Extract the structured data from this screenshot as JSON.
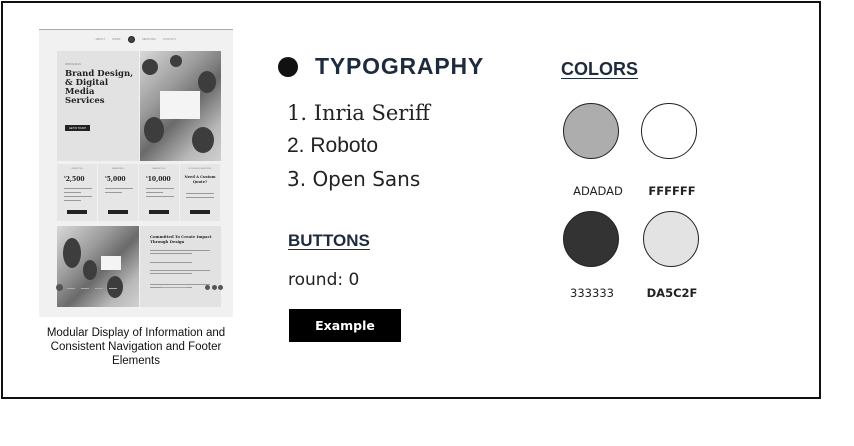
{
  "mockup": {
    "nav": [
      "ABOUT",
      "WORK",
      "SERVICES",
      "CONTACT"
    ],
    "hero_kicker": "WEB DESIGN",
    "hero_title": "Brand Design, & Digital Media Services",
    "hero_button": "GET IN TOUCH",
    "pricing": [
      {
        "kicker": "WEBSITES",
        "price": "2,500"
      },
      {
        "kicker": "BRANDING",
        "price": "5,000"
      },
      {
        "kicker": "MARKETING",
        "price": "10,000"
      }
    ],
    "custom_kicker": "IN DESIGN SERVICES",
    "custom_title": "Need A Custom Quote?",
    "feature_title": "Committed To Create Impact Through Design"
  },
  "caption": "Modular Display of Information and Consistent Navigation and Footer Elements",
  "typography": {
    "title": "TYPOGRAPHY",
    "fonts": [
      "1. Inria Seriff",
      "2. Roboto",
      "3. Open Sans"
    ]
  },
  "buttons": {
    "title": "BUTTONS",
    "round": "round: 0",
    "example_label": "Example"
  },
  "colors": {
    "title": "COLORS",
    "swatches": [
      {
        "label": "ADADAD",
        "hex": "#ADADAD"
      },
      {
        "label": "FFFFFF",
        "hex": "#FFFFFF"
      },
      {
        "label": "333333",
        "hex": "#333333"
      },
      {
        "label": "DA5C2F",
        "hex": "#E3E3E3"
      }
    ]
  }
}
